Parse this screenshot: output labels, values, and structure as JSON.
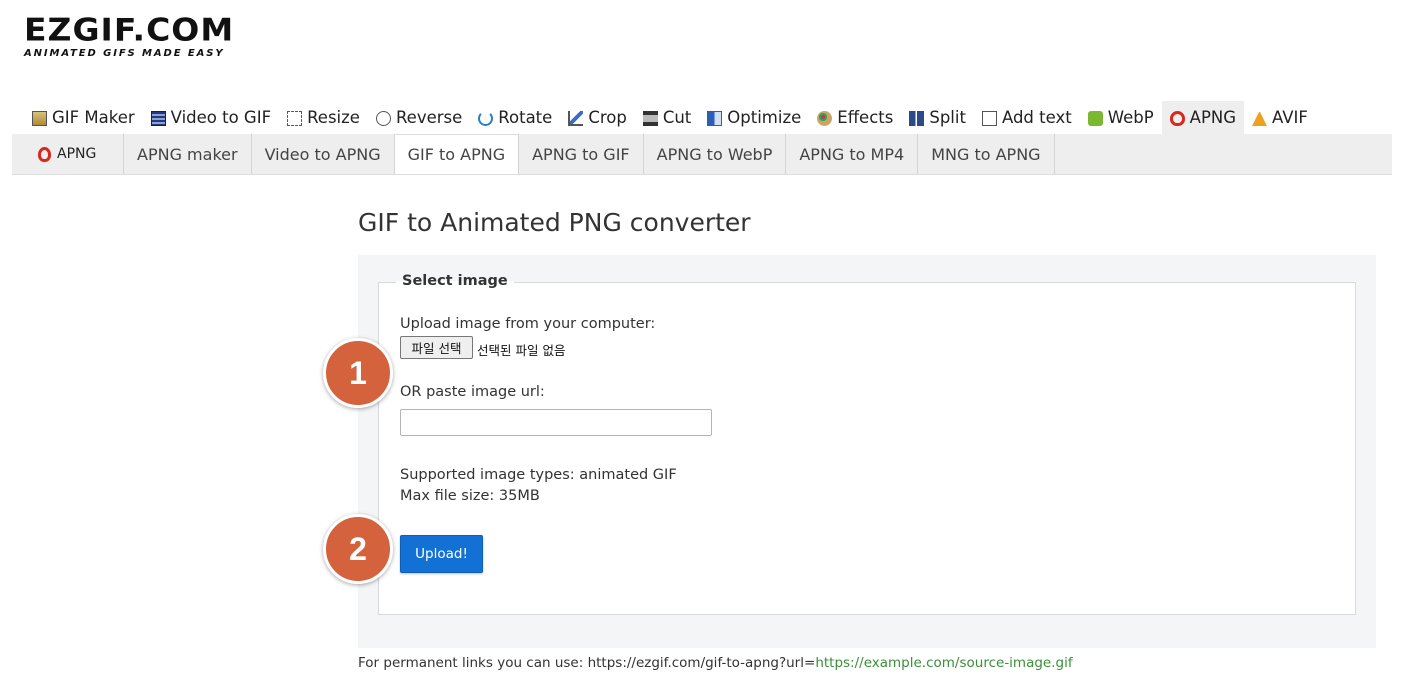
{
  "logo": {
    "main": "EZGIF.COM",
    "tagline": "ANIMATED GIFS MADE EASY"
  },
  "main_nav": [
    {
      "label": "GIF Maker",
      "icon": "gif-maker-icon"
    },
    {
      "label": "Video to GIF",
      "icon": "film-icon"
    },
    {
      "label": "Resize",
      "icon": "resize-icon"
    },
    {
      "label": "Reverse",
      "icon": "reverse-icon"
    },
    {
      "label": "Rotate",
      "icon": "rotate-icon"
    },
    {
      "label": "Crop",
      "icon": "crop-icon"
    },
    {
      "label": "Cut",
      "icon": "cut-icon"
    },
    {
      "label": "Optimize",
      "icon": "optimize-icon"
    },
    {
      "label": "Effects",
      "icon": "palette-icon"
    },
    {
      "label": "Split",
      "icon": "split-icon"
    },
    {
      "label": "Add text",
      "icon": "text-icon"
    },
    {
      "label": "WebP",
      "icon": "webp-icon"
    },
    {
      "label": "APNG",
      "icon": "apng-icon"
    },
    {
      "label": "AVIF",
      "icon": "avif-icon"
    }
  ],
  "sub_nav": {
    "brand": "APNG",
    "items": [
      "APNG maker",
      "Video to APNG",
      "GIF to APNG",
      "APNG to GIF",
      "APNG to WebP",
      "APNG to MP4",
      "MNG to APNG"
    ],
    "active": "GIF to APNG"
  },
  "page": {
    "title": "GIF to Animated PNG converter",
    "fieldset_legend": "Select image",
    "upload_label": "Upload image from your computer:",
    "file_button": "파일 선택",
    "file_status": "선택된 파일 없음",
    "url_label": "OR paste image url:",
    "url_value": "",
    "supported_types": "Supported image types: animated GIF",
    "max_size": "Max file size: 35MB",
    "upload_button": "Upload!"
  },
  "badges": {
    "step1": "1",
    "step2": "2"
  },
  "footer": {
    "prefix": "For permanent links you can use: https://ezgif.com/gif-to-apng?url=",
    "link": "https://example.com/source-image.gif"
  },
  "colors": {
    "accent": "#1371d6",
    "badge": "#d4633d",
    "apng_red": "#d9281e",
    "link_green": "#3a8f3a"
  }
}
